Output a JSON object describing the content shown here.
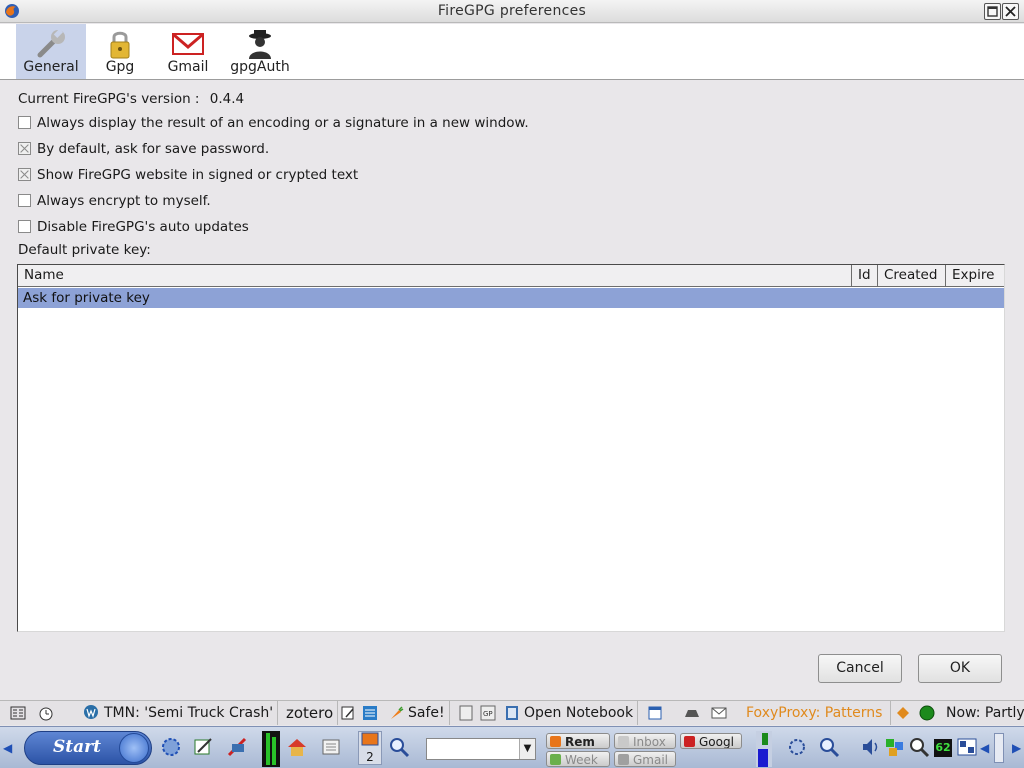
{
  "window": {
    "title": "FireGPG preferences"
  },
  "toolbar": {
    "panes": [
      {
        "label": "General",
        "icon": "wrench-icon",
        "selected": true
      },
      {
        "label": "Gpg",
        "icon": "padlock-icon",
        "selected": false
      },
      {
        "label": "Gmail",
        "icon": "gmail-icon",
        "selected": false
      },
      {
        "label": "gpgAuth",
        "icon": "gpgauth-agent-icon",
        "selected": false
      }
    ]
  },
  "general": {
    "version_label": "Current FireGPG's version :",
    "version_value": "0.4.4",
    "options": [
      {
        "label": "Always display the result of an encoding or a signature in a new window.",
        "checked": false
      },
      {
        "label": "By default, ask for save password.",
        "checked": true
      },
      {
        "label": "Show FireGPG website in signed or crypted text",
        "checked": true
      },
      {
        "label": "Always encrypt to myself.",
        "checked": false
      },
      {
        "label": "Disable FireGPG's auto updates",
        "checked": false
      }
    ],
    "private_key_label": "Default private key:",
    "key_table": {
      "columns": [
        "Name",
        "Id",
        "Created",
        "Expire"
      ],
      "rows": [
        {
          "name": "Ask for private key",
          "selected": true
        }
      ]
    }
  },
  "buttons": {
    "cancel": "Cancel",
    "ok": "OK"
  },
  "statusbar": {
    "tmn": "TMN: 'Semi Truck Crash'",
    "zotero": "zotero",
    "safe": "Safe!",
    "open_notebook": "Open Notebook",
    "foxyproxy": "FoxyProxy: Patterns",
    "now": "Now: Partly"
  },
  "taskbar": {
    "start_label": "Start",
    "workspace_number": "2",
    "tasks_row1": [
      "Rem",
      "Inbox",
      "Googl"
    ],
    "tasks_row2": [
      "Week",
      "Gmail"
    ],
    "tray_number": "62"
  },
  "colors": {
    "selection": "#8da2d6",
    "selected_pane": "#c9d3ea",
    "foxyproxy_text": "#e08a1e"
  }
}
